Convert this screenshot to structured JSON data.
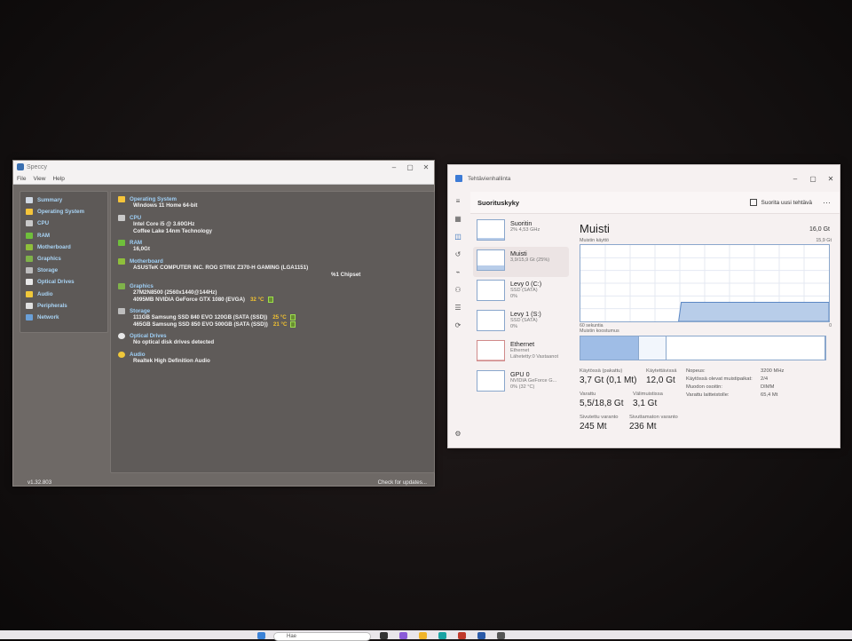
{
  "speccy": {
    "title": "Speccy",
    "menu": [
      "File",
      "View",
      "Help"
    ],
    "sidebar": [
      {
        "label": "Summary",
        "icon": "summary-icon",
        "color": "#cfd8e3"
      },
      {
        "label": "Operating System",
        "icon": "windows-icon",
        "color": "#f5c43a"
      },
      {
        "label": "CPU",
        "icon": "cpu-icon",
        "color": "#c9c9c9"
      },
      {
        "label": "RAM",
        "icon": "ram-icon",
        "color": "#6fbf3b"
      },
      {
        "label": "Motherboard",
        "icon": "motherboard-icon",
        "color": "#8fbf3b"
      },
      {
        "label": "Graphics",
        "icon": "graphics-icon",
        "color": "#7fb24a"
      },
      {
        "label": "Storage",
        "icon": "storage-icon",
        "color": "#bdbdbd"
      },
      {
        "label": "Optical Drives",
        "icon": "optical-drive-icon",
        "color": "#e8e8e8"
      },
      {
        "label": "Audio",
        "icon": "audio-icon",
        "color": "#f0c83a"
      },
      {
        "label": "Peripherals",
        "icon": "peripherals-icon",
        "color": "#e0e0e0"
      },
      {
        "label": "Network",
        "icon": "network-icon",
        "color": "#6aa0d8"
      }
    ],
    "sections": {
      "os": {
        "title": "Operating System",
        "lines": [
          "Windows 11 Home 64-bit"
        ]
      },
      "cpu": {
        "title": "CPU",
        "lines": [
          "Intel Core i5 @ 3.60GHz",
          "Coffee Lake 14nm Technology"
        ]
      },
      "ram": {
        "title": "RAM",
        "lines": [
          "16,0Gt"
        ]
      },
      "motherboard": {
        "title": "Motherboard",
        "line": "ASUSTeK COMPUTER INC. ROG STRIX Z370-H GAMING (LGA1151)",
        "chipset": "%1 Chipset"
      },
      "graphics": {
        "title": "Graphics",
        "line1": "27M2N8500 (2560x1440@144Hz)",
        "line2": "4095MB NVIDIA GeForce GTX 1080 (EVGA)",
        "temp": "32 °C"
      },
      "storage": {
        "title": "Storage",
        "disks": [
          {
            "name": "111GB Samsung SSD 840 EVO 120GB (SATA (SSD))",
            "temp": "25 °C"
          },
          {
            "name": "465GB Samsung SSD 850 EVO 500GB (SATA (SSD))",
            "temp": "21 °C"
          }
        ]
      },
      "optical": {
        "title": "Optical Drives",
        "lines": [
          "No optical disk drives detected"
        ]
      },
      "audio": {
        "title": "Audio",
        "lines": [
          "Realtek High Definition Audio"
        ]
      }
    },
    "version": "v1.32.803",
    "check_updates": "Check for updates..."
  },
  "taskmanager": {
    "title": "Tehtävienhallinta",
    "header": "Suorituskyky",
    "new_task": "Suorita uusi tehtävä",
    "more": "···",
    "items": [
      {
        "name": "Suoritin",
        "sub1": "2% 4,53 GHz",
        "sub2": "",
        "fill": 0.1,
        "type": "cpu"
      },
      {
        "name": "Muisti",
        "sub1": "3,9/15,9 Gt (25%)",
        "sub2": "",
        "fill": 0.25,
        "type": "mem"
      },
      {
        "name": "Levy 0 (C:)",
        "sub1": "SSD (SATA)",
        "sub2": "0%",
        "fill": 0,
        "type": "disk"
      },
      {
        "name": "Levy 1 (S:)",
        "sub1": "SSD (SATA)",
        "sub2": "0%",
        "fill": 0,
        "type": "disk"
      },
      {
        "name": "Ethernet",
        "sub1": "Ethernet",
        "sub2": "Lähetetty:0 Vastaanot",
        "fill": 0.05,
        "type": "eth"
      },
      {
        "name": "GPU 0",
        "sub1": "NVIDIA GeForce G...",
        "sub2": "0% (32 °C)",
        "fill": 0,
        "type": "gpu"
      }
    ],
    "detail": {
      "title": "Muisti",
      "total": "16,0 Gt",
      "usage_label": "Muistin käyttö",
      "usage_max": "15,9 Gt",
      "axis_left": "60 sekuntia",
      "axis_right": "0",
      "composition_label": "Muistin koostumus",
      "usage_fraction": 0.25,
      "composition": [
        0.24,
        0.11,
        0.65
      ],
      "stats": [
        {
          "label": "Käytössä (pakattu)",
          "value": "3,7 Gt (0,1 Mt)"
        },
        {
          "label": "Käytettävissä",
          "value": "12,0 Gt"
        },
        {
          "label": "Varattu",
          "value": "5,5/18,8 Gt"
        },
        {
          "label": "Välimuistissa",
          "value": "3,1 Gt"
        },
        {
          "label": "Sivutettu varanto",
          "value": "245 Mt"
        },
        {
          "label": "Sivuttamaton varanto",
          "value": "236 Mt"
        }
      ],
      "kv": [
        {
          "k": "Nopeus:",
          "v": "3200 MHz"
        },
        {
          "k": "Käytössä olevat muistipaikat:",
          "v": "2/4"
        },
        {
          "k": "Muodon osoitin:",
          "v": "DIMM"
        },
        {
          "k": "Varattu laitteistolle:",
          "v": "65,4 Mt"
        }
      ]
    },
    "colors": {
      "accent": "#1a5fb4",
      "mem_fill": "#b8cde9",
      "mem_line": "#5b87c4"
    }
  },
  "taskbar": {
    "search": "Hae"
  }
}
